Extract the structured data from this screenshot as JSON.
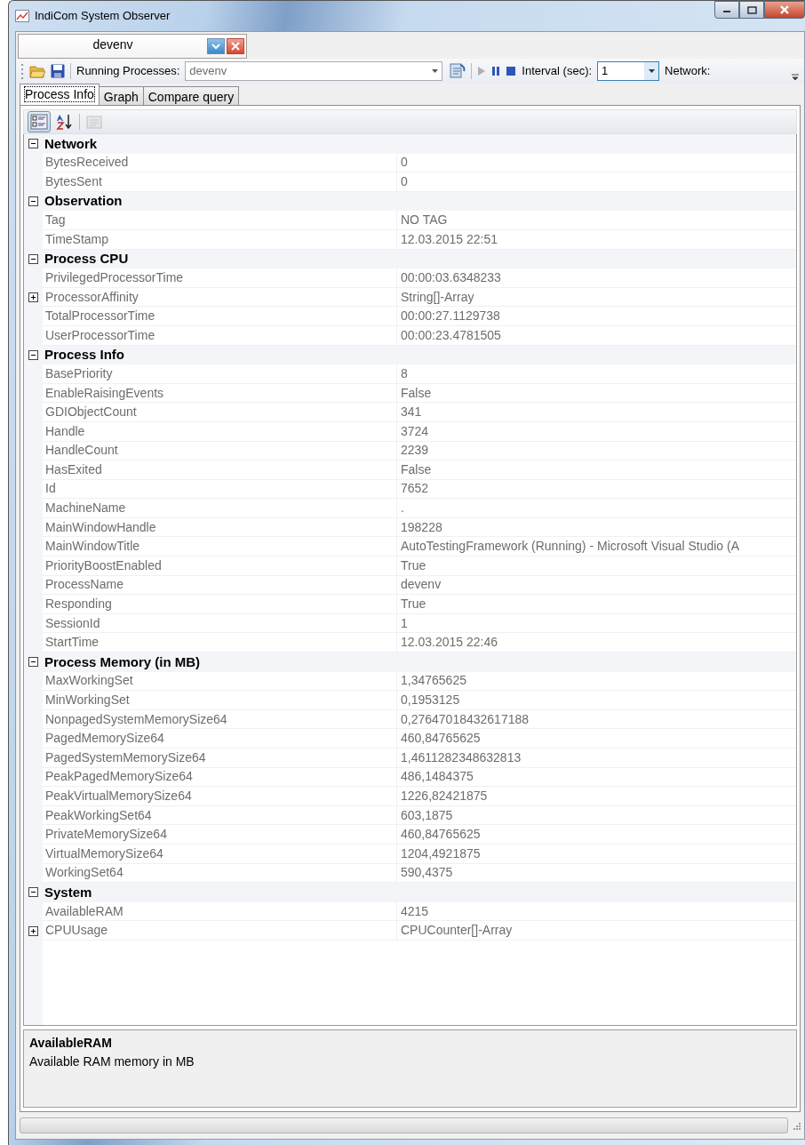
{
  "window": {
    "title": "IndiCom System Observer"
  },
  "document_tabs": [
    {
      "label": "devenv",
      "selected": true
    }
  ],
  "toolbar": {
    "process_label": "Running Processes:",
    "process_value": "devenv",
    "interval_label": "Interval (sec):",
    "interval_value": "1",
    "network_label": "Network:"
  },
  "tabs": [
    {
      "label": "Process Info",
      "selected": true
    },
    {
      "label": "Graph",
      "selected": false
    },
    {
      "label": "Compare query",
      "selected": false
    }
  ],
  "grid_tools": [
    {
      "kind": "categorized",
      "selected": true,
      "disabled": false
    },
    {
      "kind": "alphabetical",
      "selected": false,
      "disabled": false
    },
    {
      "kind": "property_pages",
      "selected": false,
      "disabled": true
    }
  ],
  "categories": [
    {
      "name": "Network",
      "expanded": true,
      "properties": [
        {
          "name": "BytesReceived",
          "value": "0",
          "kind": "plain"
        },
        {
          "name": "BytesSent",
          "value": "0",
          "kind": "plain"
        }
      ]
    },
    {
      "name": "Observation",
      "expanded": true,
      "properties": [
        {
          "name": "Tag",
          "value": "NO TAG",
          "kind": "plain"
        },
        {
          "name": "TimeStamp",
          "value": "12.03.2015 22:51",
          "kind": "plain"
        }
      ]
    },
    {
      "name": "Process CPU",
      "expanded": true,
      "properties": [
        {
          "name": "PrivilegedProcessorTime",
          "value": "00:00:03.6348233",
          "kind": "plain"
        },
        {
          "name": "ProcessorAffinity",
          "value": "String[]-Array",
          "kind": "expandable",
          "expanded": false
        },
        {
          "name": "TotalProcessorTime",
          "value": "00:00:27.1129738",
          "kind": "plain"
        },
        {
          "name": "UserProcessorTime",
          "value": "00:00:23.4781505",
          "kind": "plain"
        }
      ]
    },
    {
      "name": "Process Info",
      "expanded": true,
      "properties": [
        {
          "name": "BasePriority",
          "value": "8",
          "kind": "plain"
        },
        {
          "name": "EnableRaisingEvents",
          "value": "False",
          "kind": "plain"
        },
        {
          "name": "GDIObjectCount",
          "value": "341",
          "kind": "plain"
        },
        {
          "name": "Handle",
          "value": "3724",
          "kind": "plain"
        },
        {
          "name": "HandleCount",
          "value": "2239",
          "kind": "plain"
        },
        {
          "name": "HasExited",
          "value": "False",
          "kind": "plain"
        },
        {
          "name": "Id",
          "value": "7652",
          "kind": "plain"
        },
        {
          "name": "MachineName",
          "value": ".",
          "kind": "plain"
        },
        {
          "name": "MainWindowHandle",
          "value": "198228",
          "kind": "plain"
        },
        {
          "name": "MainWindowTitle",
          "value": "AutoTestingFramework (Running) - Microsoft Visual Studio (A",
          "kind": "plain"
        },
        {
          "name": "PriorityBoostEnabled",
          "value": "True",
          "kind": "plain"
        },
        {
          "name": "ProcessName",
          "value": "devenv",
          "kind": "plain"
        },
        {
          "name": "Responding",
          "value": "True",
          "kind": "plain"
        },
        {
          "name": "SessionId",
          "value": "1",
          "kind": "plain"
        },
        {
          "name": "StartTime",
          "value": "12.03.2015 22:46",
          "kind": "plain"
        }
      ]
    },
    {
      "name": "Process Memory (in MB)",
      "expanded": true,
      "properties": [
        {
          "name": "MaxWorkingSet",
          "value": "1,34765625",
          "kind": "plain"
        },
        {
          "name": "MinWorkingSet",
          "value": "0,1953125",
          "kind": "plain"
        },
        {
          "name": "NonpagedSystemMemorySize64",
          "value": "0,27647018432617188",
          "kind": "plain"
        },
        {
          "name": "PagedMemorySize64",
          "value": "460,84765625",
          "kind": "plain"
        },
        {
          "name": "PagedSystemMemorySize64",
          "value": "1,4611282348632813",
          "kind": "plain"
        },
        {
          "name": "PeakPagedMemorySize64",
          "value": "486,1484375",
          "kind": "plain"
        },
        {
          "name": "PeakVirtualMemorySize64",
          "value": "1226,82421875",
          "kind": "plain"
        },
        {
          "name": "PeakWorkingSet64",
          "value": "603,1875",
          "kind": "plain"
        },
        {
          "name": "PrivateMemorySize64",
          "value": "460,84765625",
          "kind": "plain"
        },
        {
          "name": "VirtualMemorySize64",
          "value": "1204,4921875",
          "kind": "plain"
        },
        {
          "name": "WorkingSet64",
          "value": "590,4375",
          "kind": "plain"
        }
      ]
    },
    {
      "name": "System",
      "expanded": true,
      "properties": [
        {
          "name": "AvailableRAM",
          "value": "4215",
          "kind": "plain"
        },
        {
          "name": "CPUUsage",
          "value": "CPUCounter[]-Array",
          "kind": "expandable",
          "expanded": false
        }
      ]
    }
  ],
  "description": {
    "title": "AvailableRAM",
    "text": "Available RAM memory in MB"
  },
  "status_bar": {
    "progress": {
      "level": 0
    }
  }
}
